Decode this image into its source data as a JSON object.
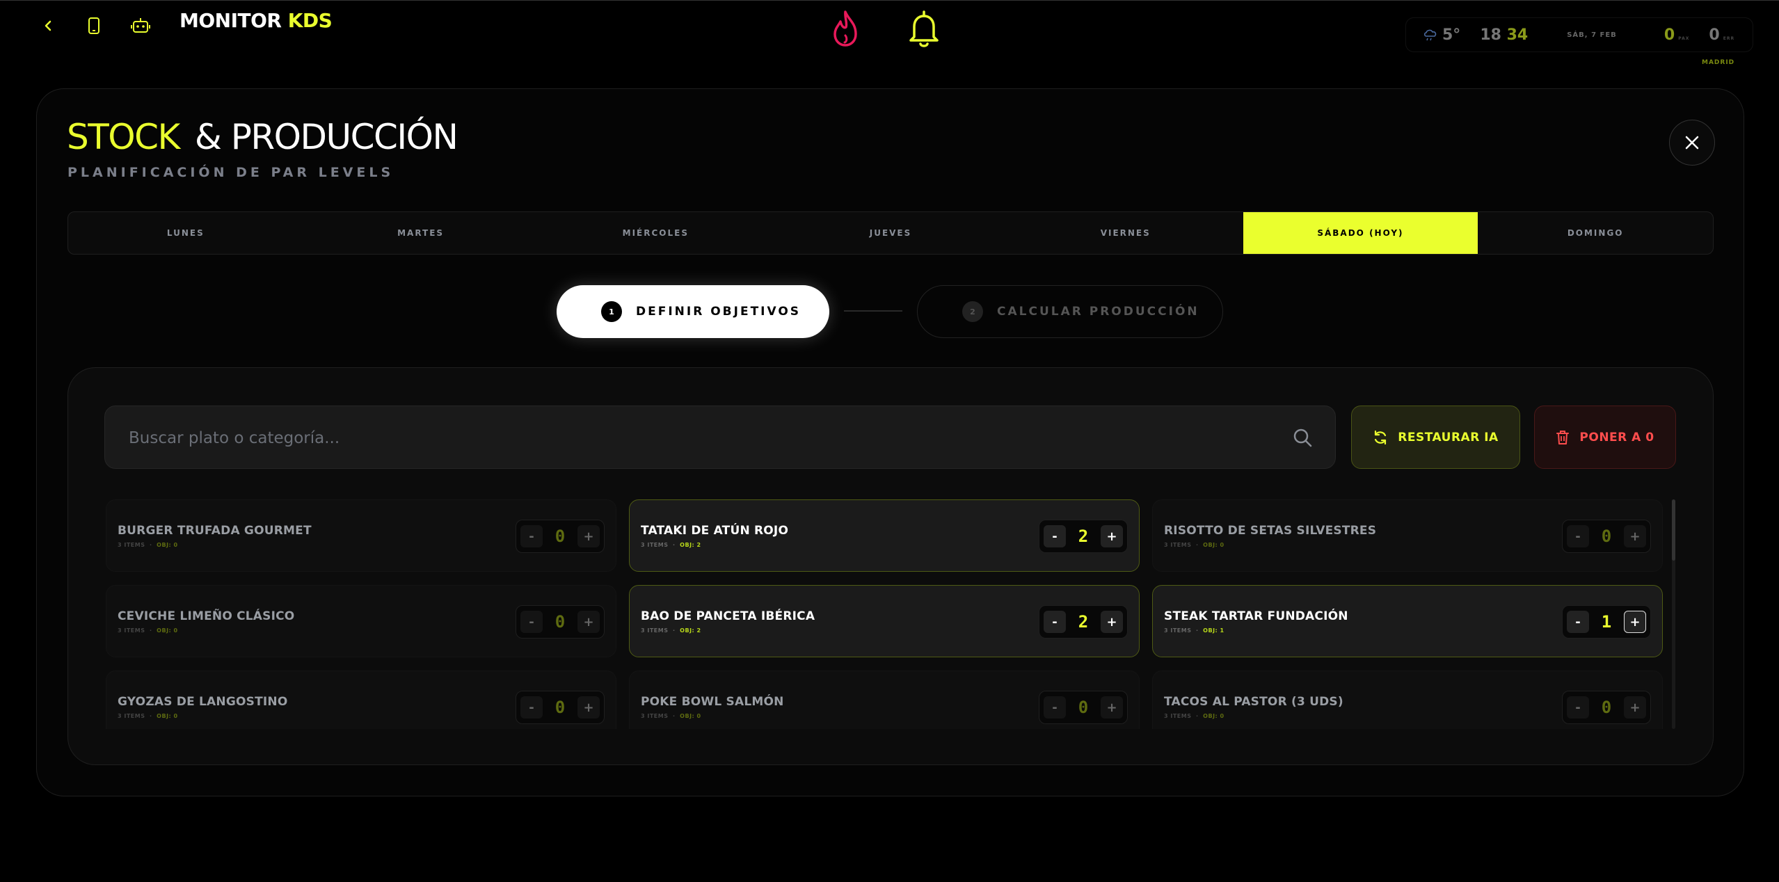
{
  "topbar": {
    "logo_main": "MONITOR",
    "logo_accent": "KDS",
    "weather_temp": "5°",
    "time_hours": "18",
    "time_minutes": "34",
    "date": "SÁB, 7 FEB",
    "counter1_value": "0",
    "counter1_unit": "PAX",
    "counter2_value": "0",
    "counter2_unit": "ERR",
    "city": "MADRID"
  },
  "modal": {
    "title_accent": "STOCK",
    "title_main": "& PRODUCCIÓN",
    "subtitle": "PLANIFICACIÓN DE PAR LEVELS"
  },
  "days": [
    {
      "label": "LUNES",
      "active": false
    },
    {
      "label": "MARTES",
      "active": false
    },
    {
      "label": "MIÉRCOLES",
      "active": false
    },
    {
      "label": "JUEVES",
      "active": false
    },
    {
      "label": "VIERNES",
      "active": false
    },
    {
      "label": "SÁBADO (HOY)",
      "active": true
    },
    {
      "label": "DOMINGO",
      "active": false
    }
  ],
  "steps": [
    {
      "num": "1",
      "label": "DEFINIR OBJETIVOS"
    },
    {
      "num": "2",
      "label": "CALCULAR PRODUCCIÓN"
    }
  ],
  "search": {
    "placeholder": "Buscar plato o categoría..."
  },
  "actions": {
    "restore_label": "RESTAURAR IA",
    "zero_label": "PONER A 0"
  },
  "items": [
    {
      "name": "BURGER TRUFADA GOURMET",
      "items": "3 ITEMS",
      "obj": "OBJ: 0",
      "value": "0",
      "active": false
    },
    {
      "name": "TATAKI DE ATÚN ROJO",
      "items": "3 ITEMS",
      "obj": "OBJ: 2",
      "value": "2",
      "active": true
    },
    {
      "name": "RISOTTO DE SETAS SILVESTRES",
      "items": "3 ITEMS",
      "obj": "OBJ: 0",
      "value": "0",
      "active": false
    },
    {
      "name": "CEVICHE LIMEÑO CLÁSICO",
      "items": "3 ITEMS",
      "obj": "OBJ: 0",
      "value": "0",
      "active": false
    },
    {
      "name": "BAO DE PANCETA IBÉRICA",
      "items": "3 ITEMS",
      "obj": "OBJ: 2",
      "value": "2",
      "active": true
    },
    {
      "name": "STEAK TARTAR FUNDACIÓN",
      "items": "3 ITEMS",
      "obj": "OBJ: 1",
      "value": "1",
      "active": true
    },
    {
      "name": "GYOZAS DE LANGOSTINO",
      "items": "3 ITEMS",
      "obj": "OBJ: 0",
      "value": "0",
      "active": false
    },
    {
      "name": "POKE BOWL SALMÓN",
      "items": "3 ITEMS",
      "obj": "OBJ: 0",
      "value": "0",
      "active": false
    },
    {
      "name": "TACOS AL PASTOR (3 UDS)",
      "items": "3 ITEMS",
      "obj": "OBJ: 0",
      "value": "0",
      "active": false
    }
  ],
  "colors": {
    "accent": "#eaff2e",
    "danger": "#ff4d4d",
    "flame": "#e8195a"
  }
}
